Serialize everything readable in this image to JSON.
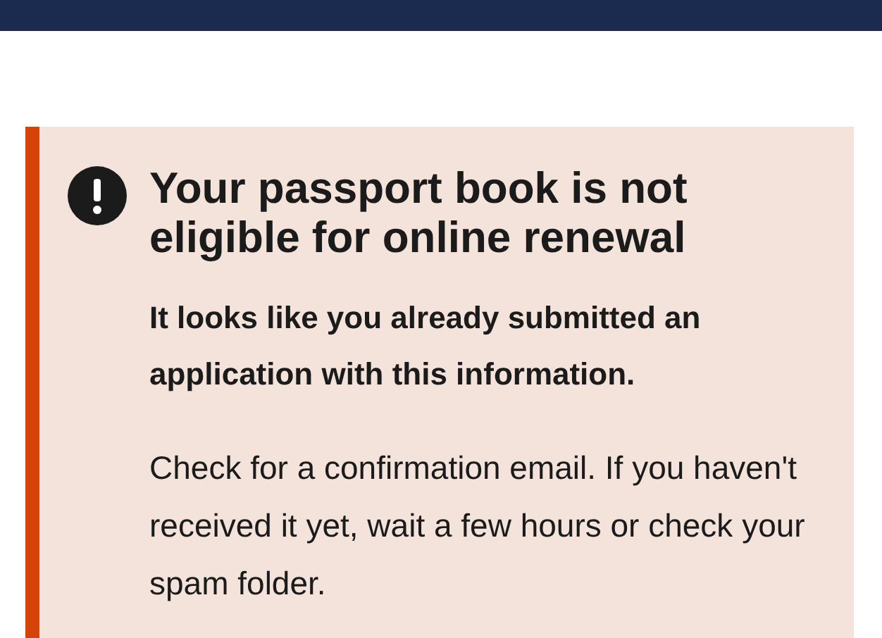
{
  "alert": {
    "kind": "error",
    "heading": "Your passport book is not eligible for online renewal",
    "lead": "It looks like you already submitted an application with this information.",
    "body": "Check for a confirmation email. If you haven't received it yet, wait a few hours or check your spam folder."
  }
}
